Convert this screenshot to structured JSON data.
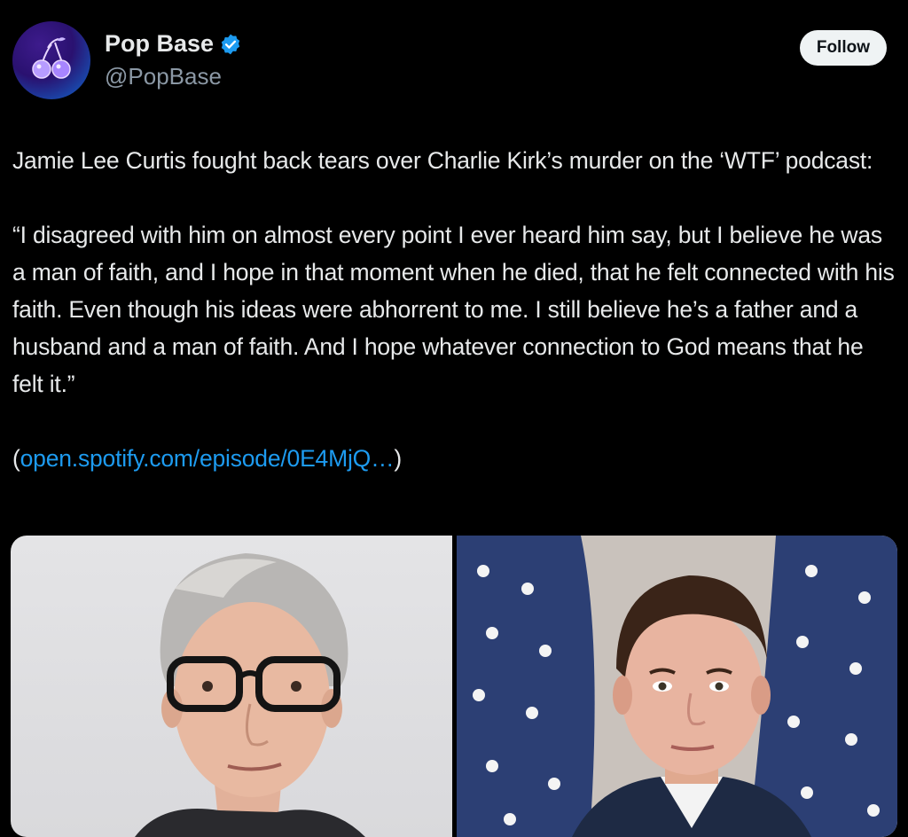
{
  "account": {
    "name": "Pop Base",
    "handle": "@PopBase",
    "verified": true,
    "follow_label": "Follow"
  },
  "post": {
    "intro": "Jamie Lee Curtis fought back tears over Charlie Kirk’s murder on the ‘WTF’ podcast:",
    "quote": "“I disagreed with him on almost every point I ever heard him say, but I believe he was a man of faith, and I hope in that moment when he died, that he felt connected with his faith. Even though his ideas were abhorrent to me. I still believe he’s a father and a husband and a man of faith. And I hope whatever connection to God means that he felt it.”",
    "link_open": "(",
    "link_text": "open.spotify.com/episode/0E4MjQ…",
    "link_close": ")"
  },
  "media": {
    "images": [
      "woman-glasses-portrait-photo",
      "man-flags-portrait-photo"
    ]
  },
  "colors": {
    "background": "#000000",
    "text": "#e7e9ea",
    "secondary": "#8b98a5",
    "link": "#1d9bf0",
    "verified": "#1d9bf0"
  }
}
